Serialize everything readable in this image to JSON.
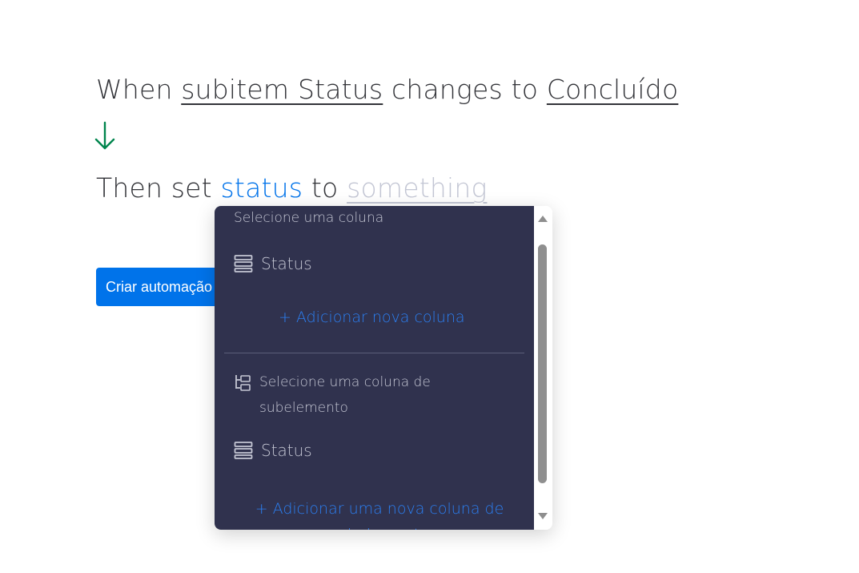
{
  "rule": {
    "when_word": "When",
    "trigger_column": "subitem Status",
    "changes_to_word": "changes to",
    "trigger_value": "Concluído",
    "then_set_word": "Then set",
    "target_column": "status",
    "to_word": "to",
    "target_value_placeholder": "something"
  },
  "create_button_label": "Criar automação",
  "dropdown": {
    "main_group_title": "Selecione uma coluna",
    "main_option": "Status",
    "add_column_link": "+ Adicionar nova coluna",
    "sub_group_title": "Selecione uma coluna de subelemento",
    "sub_option": "Status",
    "add_subcolumn_link": "+ Adicionar uma nova coluna de subelemento"
  },
  "colors": {
    "accent": "#0073ea",
    "arrow": "#00854d",
    "dropdown_bg": "#30324e"
  },
  "icons": {
    "arrow": "arrow-down-icon",
    "column": "status-column-icon",
    "subitems": "subitems-icon"
  }
}
